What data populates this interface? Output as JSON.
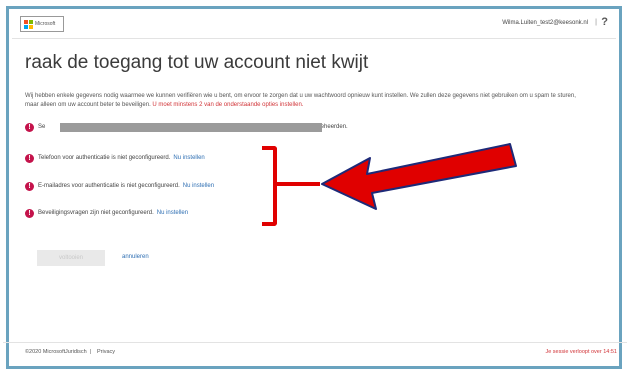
{
  "header": {
    "logo_text": "Microsoft",
    "user_email": "Wilma.Luiten_test2@keesonk.nl",
    "separator": "|",
    "help_label": "?"
  },
  "main": {
    "title": "raak de toegang tot uw account niet kwijt",
    "intro_text": "Wij hebben enkele gegevens nodig waarmee we kunnen verifiëren wie u bent, om ervoor te zorgen dat u uw wachtwoord opnieuw kunt instellen. We zullen deze gegevens niet gebruiken om u spam te sturen, maar alleen om uw account beter te beveiligen.",
    "intro_required": "U moet minstens 2 van de onderstaande opties instellen.",
    "redacted_row_visible_start": "Se",
    "redacted_row_visible_end": "beheerden.",
    "items": [
      {
        "text": "Telefoon voor authenticatie is niet geconfigureerd.",
        "link": "Nu instellen"
      },
      {
        "text": "E-mailadres voor authenticatie is niet geconfigureerd.",
        "link": "Nu instellen"
      },
      {
        "text": "Beveiligingsvragen zijn niet geconfigureerd.",
        "link": "Nu instellen"
      }
    ],
    "next_button": "voltooien",
    "cancel_link": "annuleren"
  },
  "footer": {
    "copyright": "©2020 Microsoft",
    "link_legal": "Juridisch",
    "separator": "|",
    "link_privacy": "Privacy",
    "session_text": "Je sessie verloopt over 14:51"
  },
  "colors": {
    "frame_border": "#6aa3bf",
    "warning_icon": "#c4134b",
    "link": "#2f6fb3",
    "annotation_red": "#e00000",
    "required_text": "#d13438"
  },
  "icons": [
    "microsoft-logo-icon",
    "warning-icon",
    "annotation-arrow-icon"
  ]
}
